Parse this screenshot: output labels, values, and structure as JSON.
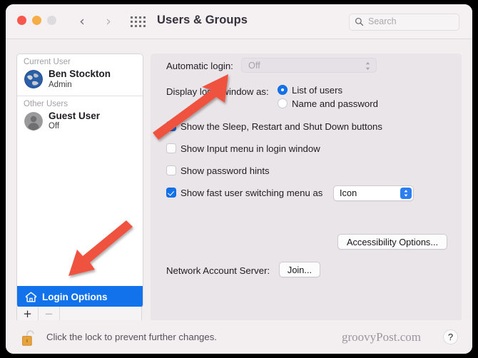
{
  "window": {
    "title": "Users & Groups",
    "traffic_lights": [
      "close-red",
      "minimize-amber",
      "zoom-disabled-grey"
    ],
    "nav": {
      "back": "‹",
      "forward": "›"
    },
    "grid_button": "show-all-grid"
  },
  "search": {
    "placeholder": "Search",
    "icon": "search-icon"
  },
  "sidebar": {
    "groups": [
      {
        "label": "Current User",
        "users": [
          {
            "name": "Ben Stockton",
            "status": "Admin",
            "avatar": "earth-globe-avatar"
          }
        ]
      },
      {
        "label": "Other Users",
        "users": [
          {
            "name": "Guest User",
            "status": "Off",
            "avatar": "person-silhouette-avatar"
          }
        ]
      }
    ],
    "login_options": {
      "label": "Login Options",
      "icon": "home-house-icon",
      "selected": true,
      "highlight_color": "#1272ec"
    },
    "toolbar": {
      "add": "+",
      "remove": "−"
    }
  },
  "main": {
    "automatic_login": {
      "label": "Automatic login:",
      "value": "Off",
      "enabled": false
    },
    "display_login_window": {
      "label": "Display login window as:",
      "options": [
        {
          "label": "List of users",
          "selected": true
        },
        {
          "label": "Name and password",
          "selected": false
        }
      ]
    },
    "checkboxes": [
      {
        "label": "Show the Sleep, Restart and Shut Down buttons",
        "checked": true
      },
      {
        "label": "Show Input menu in login window",
        "checked": false
      },
      {
        "label": "Show password hints",
        "checked": false
      },
      {
        "label": "Show fast user switching menu as",
        "checked": true
      }
    ],
    "fast_switching_popup": {
      "value": "Icon",
      "enabled": true
    },
    "accessibility_button": "Accessibility Options...",
    "network_account_server": {
      "label": "Network Account Server:",
      "button": "Join..."
    }
  },
  "footer": {
    "lock_icon": "unlocked-padlock-icon",
    "lock_text": "Click the lock to prevent further changes.",
    "watermark": "groovyPost.com",
    "help": "?"
  },
  "annotations": {
    "arrow_color": "#ef5340",
    "arrows": [
      {
        "name": "arrow-to-automatic-login",
        "points_to": "automatic-login-popup"
      },
      {
        "name": "arrow-to-login-options",
        "points_to": "sidebar-login-options"
      }
    ]
  }
}
